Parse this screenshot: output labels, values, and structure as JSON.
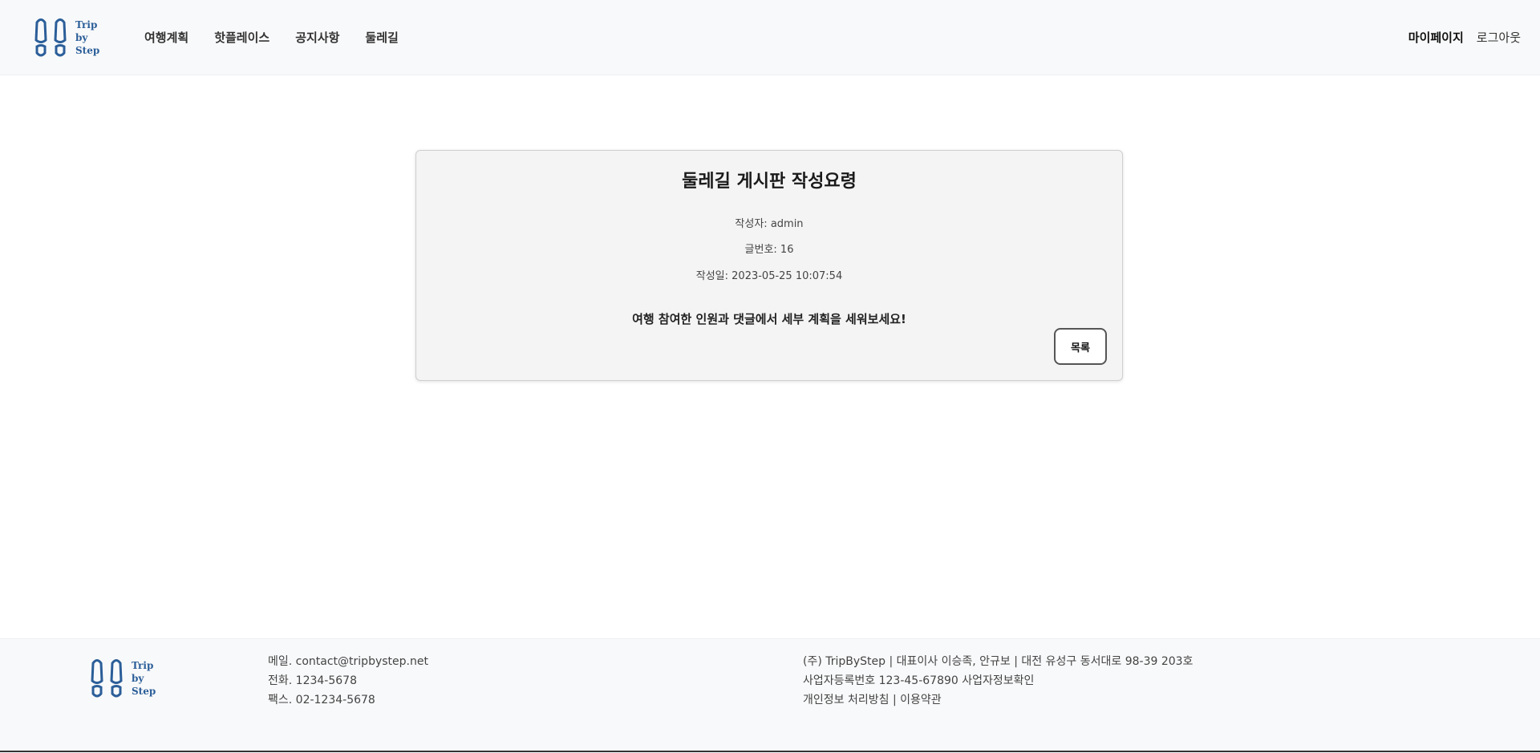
{
  "brand": {
    "logo_line1": "Trip",
    "logo_line2": "by",
    "logo_line3": "Step",
    "color": "#2b5e99"
  },
  "nav": {
    "items": [
      {
        "label": "여행계획"
      },
      {
        "label": "핫플레이스"
      },
      {
        "label": "공지사항"
      },
      {
        "label": "둘레길"
      }
    ]
  },
  "user_nav": {
    "mypage": "마이페이지",
    "logout": "로그아웃"
  },
  "post": {
    "title": "둘레길 게시판 작성요령",
    "author": "작성자: admin",
    "number": "글번호: 16",
    "date": "작성일: 2023-05-25 10:07:54",
    "content": "여행 참여한 인원과 댓글에서 세부 계획을 세워보세요!",
    "list_button": "목록"
  },
  "footer": {
    "contact": {
      "email": "메일. contact@tripbystep.net",
      "phone": "전화. 1234-5678",
      "fax": "팩스. 02-1234-5678"
    },
    "company": {
      "line1": "(주) TripByStep | 대표이사 이승족, 안규보 | 대전 유성구 동서대로 98-39 203호",
      "line2": "사업자등록번호 123-45-67890 사업자정보확인",
      "line3": "개인정보 처리방침 | 이용약관"
    }
  }
}
